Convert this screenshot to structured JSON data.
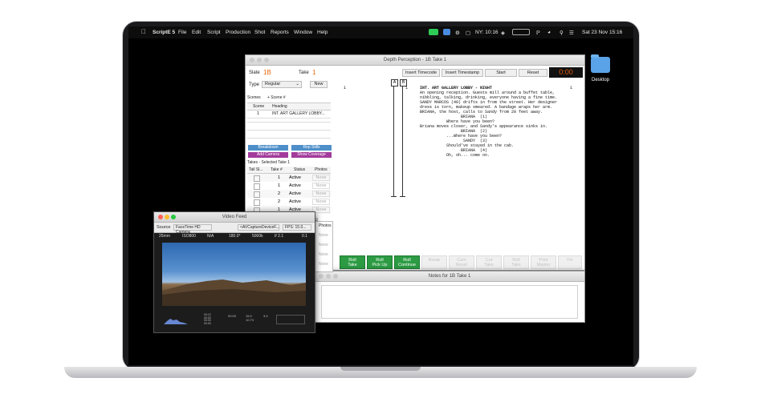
{
  "menubar": {
    "app_name": "ScriptE 5",
    "items": [
      "File",
      "Edit",
      "Script",
      "Production",
      "Shot",
      "Reports",
      "Window",
      "Help"
    ],
    "clock_ny": "NY: 10:16",
    "date_time": "Sat 23 Nov   15:16"
  },
  "desktop": {
    "folder_label": "Desktop"
  },
  "main_window": {
    "title": "Depth Perception - 1B Take 1",
    "slate_label": "Slate",
    "slate_value": "1B",
    "take_label": "Take",
    "take_value": "1",
    "type_label": "Type",
    "type_value": "Regular",
    "new_button": "New",
    "scenes_label": "Scenes",
    "scene_hash_label": "+ Scene #",
    "scene_col_header": "Scene",
    "heading_col_header": "Heading",
    "scene_row": {
      "scene": "1",
      "heading": "INT. ART GALLERY LOBBY..."
    },
    "breakdown_button": "Breakdown",
    "rep_stills_button": "Rep Stills",
    "add_camera_button": "Add Camera",
    "show_coverage_button": "Show Coverage",
    "takes_label": "Takes - Selected Take  1",
    "takes_headers": [
      "Tail Sl...",
      "Take #",
      "Status",
      "Photos"
    ],
    "takes_rows": [
      {
        "take": "1",
        "status": "Active",
        "photos": "None"
      },
      {
        "take": "1",
        "status": "Active",
        "photos": "None"
      },
      {
        "take": "2",
        "status": "Active",
        "photos": "None"
      },
      {
        "take": "2",
        "status": "Active",
        "photos": "None"
      },
      {
        "take": "1",
        "status": "Active",
        "photos": "None"
      }
    ],
    "bottom_tabs": [
      "Other Setup/Takes",
      "Other Wild Tracks"
    ],
    "insert_timecode": "Insert Timecode",
    "insert_timestamp": "Insert Timestamp",
    "start_button": "Start",
    "reset_button": "Reset",
    "timer": "0:00",
    "camera_marks": [
      "A",
      "B"
    ],
    "script": {
      "left_number": "1",
      "right_number": "1",
      "left_scene_number": "1",
      "lines": [
        "INT. ART GALLERY LOBBY - NIGHT",
        "",
        "An opening reception. Guests mill around a buffet table,",
        "nibbling, talking, drinking, everyone having a fine time.",
        "",
        "SANDY MARCOS (40) drifts in from the street. Her designer",
        "dress is torn, makeup smeared. A bandage wraps her arm.",
        "",
        "BRIANA, the host, calls to Sandy from 20 feet away.",
        "",
        "                 BRIANA  (1)",
        "           Where have you been?",
        "",
        "Briana moves closer, and Sandy's appearance sinks in.",
        "",
        "                 BRIANA  (2)",
        "           ...Where have you been?",
        "",
        "                  SANDY  (3)",
        "           Should've stayed in the cab.",
        "",
        "                 BRIANA  (4)",
        "           Oh, oh... come on."
      ]
    },
    "roll_buttons": [
      "Roll\nTake",
      "Roll\nPick Up",
      "Roll\nContinue"
    ],
    "disabled_buttons": [
      "Break",
      "Cam\nReset",
      "Cut\nTake",
      "Roll\nTake",
      "Print\nMaster",
      "Fix",
      "Extra\nFix"
    ]
  },
  "notes_window": {
    "title": "Notes for 1B Take 1"
  },
  "video_window": {
    "title": "Video Feed",
    "source_label": "Source",
    "source_value": "FaceTime HD Camera",
    "device_value": "<AVCaptureDeviceF...",
    "fps_value": "FPS: 15.0...",
    "stats": [
      "25mm",
      "ISO800",
      "N/A",
      "180.0°",
      "5000k",
      "f/ 2.1",
      "0.1"
    ],
    "overlay_values": [
      "00:12",
      "00:00",
      "00:00",
      "00:00",
      "00:00",
      "15.0",
      "10.7V",
      "3.5"
    ]
  },
  "side_panel": {
    "header": "Photos",
    "items": [
      "None",
      "None",
      "None",
      "None"
    ]
  }
}
